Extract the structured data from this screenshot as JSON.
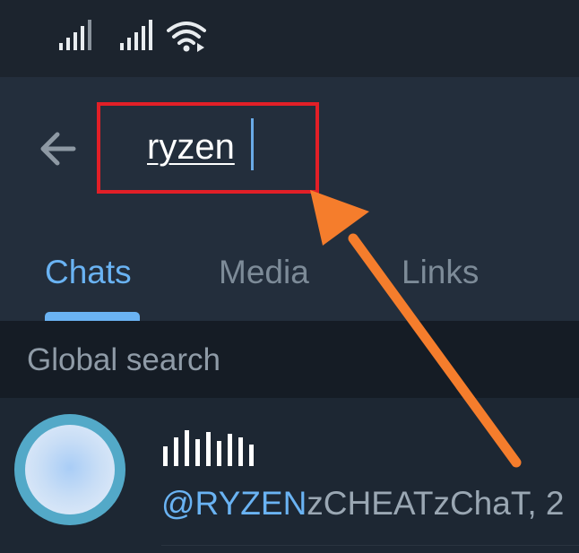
{
  "search": {
    "query": "ryzen",
    "highlight_color": "#e21f27"
  },
  "tabs": [
    {
      "label": "Chats",
      "active": true
    },
    {
      "label": "Media",
      "active": false
    },
    {
      "label": "Links",
      "active": false
    }
  ],
  "section": {
    "title": "Global search"
  },
  "results": [
    {
      "username_highlight": "@RYZEN",
      "username_rest": "zCHEATzChaT, 2",
      "avatar_color": "#53a9c8"
    }
  ],
  "colors": {
    "accent": "#6ab3f3",
    "annotation_arrow": "#f57d2c"
  },
  "icons": [
    "signal-icon",
    "wifi-icon",
    "back-arrow-icon"
  ]
}
